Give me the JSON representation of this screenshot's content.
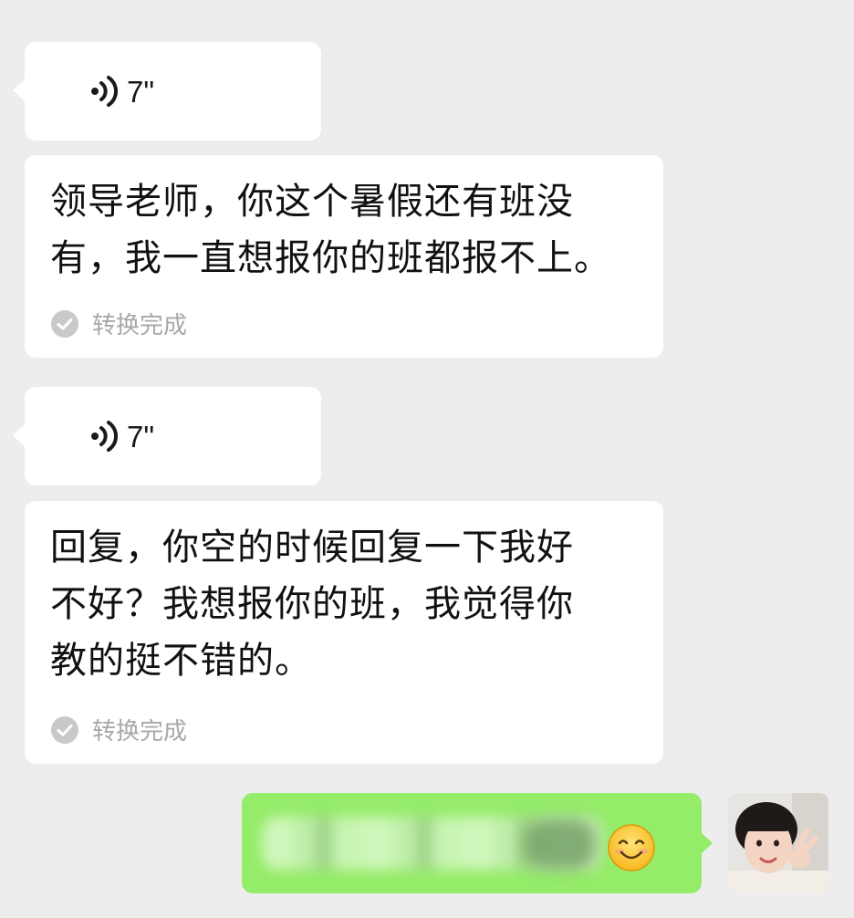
{
  "messages": [
    {
      "voice_duration": "7\"",
      "transcript": "领导老师，你这个暑假还有班没\n有，我一直想报你的班都报不上。",
      "status": "转换完成"
    },
    {
      "voice_duration": "7\"",
      "transcript": "回复，你空的时候回复一下我好\n不好？我想报你的班，我觉得你\n教的挺不错的。",
      "status": "转换完成"
    }
  ],
  "reply": {
    "emoji_icon": "smiling-face-emoji",
    "text_blurred": true
  },
  "colors": {
    "background": "#ededed",
    "incoming_bubble": "#ffffff",
    "outgoing_bubble": "#95ec69",
    "status_text": "#a8a8a8"
  },
  "icons": {
    "voice": "voice-wave-icon",
    "check": "check-circle-icon"
  }
}
